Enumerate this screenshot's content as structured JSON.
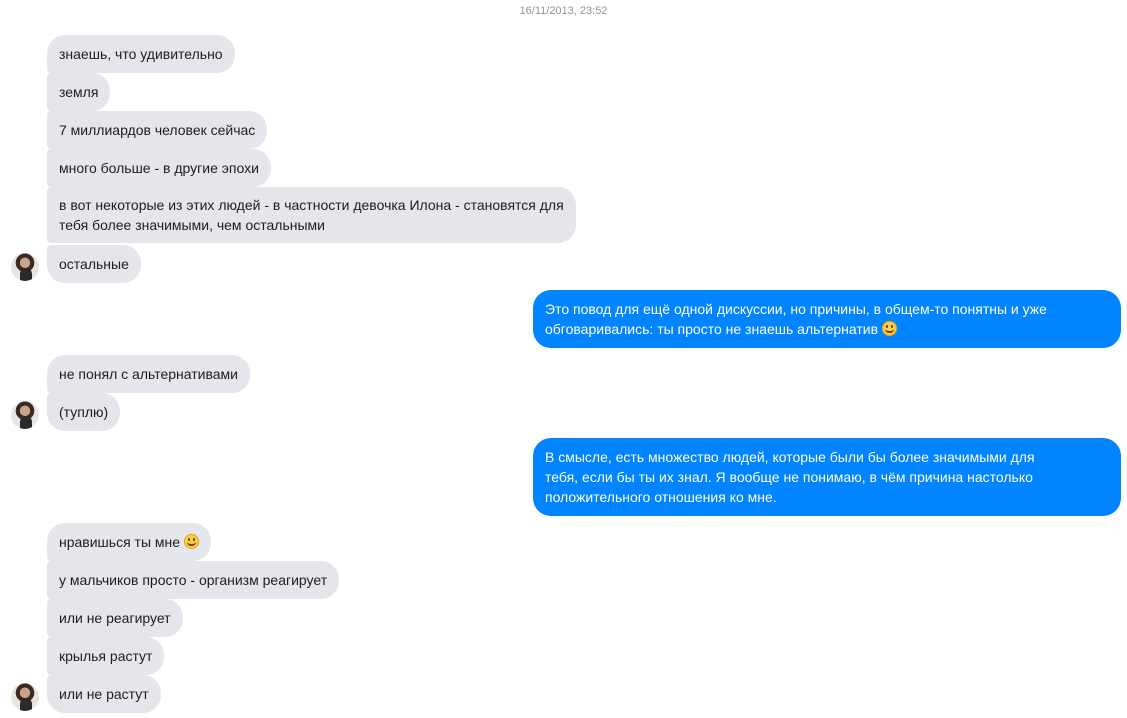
{
  "timestamp": "16/11/2013, 23:52",
  "messages": {
    "m1": "знаешь, что удивительно",
    "m2": "земля",
    "m3": "7 миллиардов человек сейчас",
    "m4": "много больше - в другие эпохи",
    "m5_line1": "в вот некоторые из этих людей -  в частности девочка Илона - становятся для",
    "m5_line2": "тебя более значимыми, чем остальными",
    "m6": "остальные",
    "o1_line1": "Это повод для ещё одной дискуссии, но причины, в общем-то понятны и уже",
    "o1_line2": "обговаривались: ты просто не знаешь альтернатив",
    "m7": "не понял с альтернативами",
    "m8": "(туплю)",
    "o2_line1": "В смысле, есть множество людей, которые были бы более значимыми для",
    "o2_line2": "тебя, если бы ты их знал. Я вообще не понимаю, в чём причина настолько",
    "o2_line3": "положительного отношения ко мне.",
    "m9": "нравишься ты мне",
    "m10": "у мальчиков просто - организм реагирует",
    "m11": "или не реагирует",
    "m12": "крылья растут",
    "m13": "или не растут"
  },
  "icons": {
    "avatar": "contact-avatar",
    "emoji": "smiley-emoji-icon"
  },
  "colors": {
    "incoming": "#e4e6eb",
    "outgoing": "#0084ff",
    "timestamp": "#90949c"
  }
}
